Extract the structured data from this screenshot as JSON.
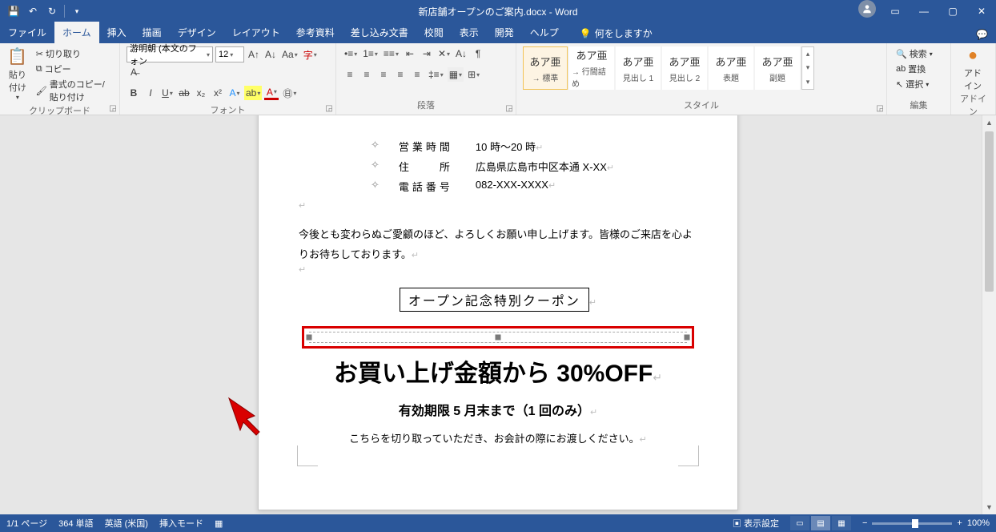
{
  "title": "新店舗オープンのご案内.docx - Word",
  "tabs": {
    "file": "ファイル",
    "home": "ホーム",
    "insert": "挿入",
    "draw": "描画",
    "design": "デザイン",
    "layout": "レイアウト",
    "references": "参考資料",
    "mailings": "差し込み文書",
    "review": "校閲",
    "view": "表示",
    "developer": "開発",
    "help": "ヘルプ"
  },
  "tellme": "何をしますか",
  "ribbon": {
    "clipboard": {
      "label": "クリップボード",
      "paste": "貼り付け",
      "cut": "切り取り",
      "copy": "コピー",
      "formatpainter": "書式のコピー/貼り付け"
    },
    "font": {
      "label": "フォント",
      "name": "游明朝 (本文のフォン",
      "size": "12"
    },
    "paragraph": {
      "label": "段落"
    },
    "styles": {
      "label": "スタイル",
      "items": [
        {
          "prev": "あア亜",
          "name": "→ 標準"
        },
        {
          "prev": "あア亜",
          "name": "→ 行間詰め"
        },
        {
          "prev": "あア亜",
          "name": "見出し 1"
        },
        {
          "prev": "あア亜",
          "name": "見出し 2"
        },
        {
          "prev": "あア亜",
          "name": "表題"
        },
        {
          "prev": "あア亜",
          "name": "副題"
        }
      ]
    },
    "editing": {
      "label": "編集",
      "find": "検索",
      "replace": "置換",
      "select": "選択"
    },
    "addin": {
      "label": "アドイン",
      "btn": "アド\nイン"
    }
  },
  "doc": {
    "hours_label": "営業時間",
    "hours_val": "10 時～20 時",
    "addr_label": "住　　所",
    "addr_val": "広島県広島市中区本通 X-XX",
    "tel_label": "電話番号",
    "tel_val": "082-XXX-XXXX",
    "body": "今後とも変わらぬご愛顧のほど、よろしくお願い申し上げます。皆様のご来店を心よりお待ちしております。",
    "coupon_title": "オープン記念特別クーポン",
    "off": "お買い上げ金額から 30%OFF",
    "valid": "有効期限 5 月末まで（1 回のみ）",
    "note": "こちらを切り取っていただき、お会計の際にお渡しください。"
  },
  "status": {
    "page": "1/1 ページ",
    "words": "364 単語",
    "lang": "英語 (米国)",
    "mode": "挿入モード",
    "display": "表示設定",
    "zoom": "100%"
  }
}
